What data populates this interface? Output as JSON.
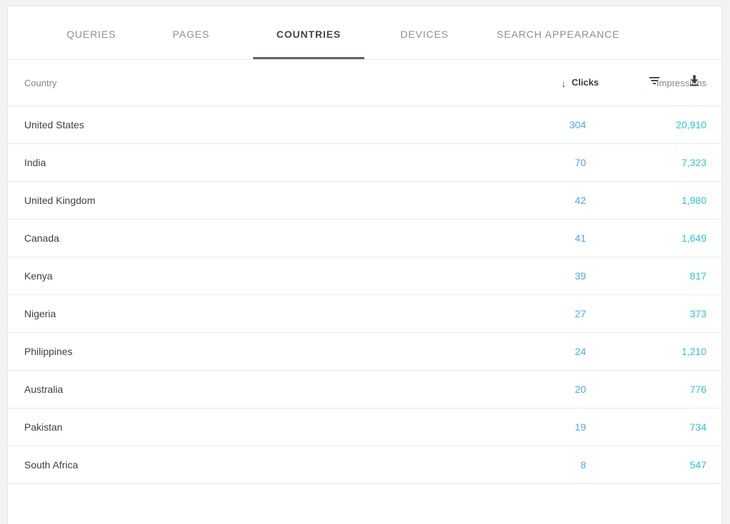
{
  "tabs": [
    {
      "label": "QUERIES",
      "key": "queries",
      "active": false
    },
    {
      "label": "PAGES",
      "key": "pages",
      "active": false
    },
    {
      "label": "COUNTRIES",
      "key": "countries",
      "active": true
    },
    {
      "label": "DEVICES",
      "key": "devices",
      "active": false
    },
    {
      "label": "SEARCH APPEARANCE",
      "key": "appearance",
      "active": false
    }
  ],
  "toolbar": {
    "filter_icon": "filter-icon",
    "download_icon": "download-icon"
  },
  "table": {
    "columns": {
      "country": "Country",
      "clicks": "Clicks",
      "impressions": "Impressions"
    },
    "sort": {
      "column": "clicks",
      "direction": "desc",
      "arrow_glyph": "↓"
    },
    "rows": [
      {
        "country": "United States",
        "clicks": "304",
        "impressions": "20,910"
      },
      {
        "country": "India",
        "clicks": "70",
        "impressions": "7,323"
      },
      {
        "country": "United Kingdom",
        "clicks": "42",
        "impressions": "1,980"
      },
      {
        "country": "Canada",
        "clicks": "41",
        "impressions": "1,649"
      },
      {
        "country": "Kenya",
        "clicks": "39",
        "impressions": "817"
      },
      {
        "country": "Nigeria",
        "clicks": "27",
        "impressions": "373"
      },
      {
        "country": "Philippines",
        "clicks": "24",
        "impressions": "1,210"
      },
      {
        "country": "Australia",
        "clicks": "20",
        "impressions": "776"
      },
      {
        "country": "Pakistan",
        "clicks": "19",
        "impressions": "734"
      },
      {
        "country": "South Africa",
        "clicks": "8",
        "impressions": "547"
      }
    ]
  },
  "colors": {
    "clicks_value": "#4aa8f0",
    "impressions_value": "#2bc4de",
    "active_tab": "#444746",
    "inactive_tab": "#8b9096",
    "tab_underline": "#5f6368",
    "page_background": "#f1f3f4",
    "card_background": "#ffffff",
    "divider": "#e8eaed"
  }
}
